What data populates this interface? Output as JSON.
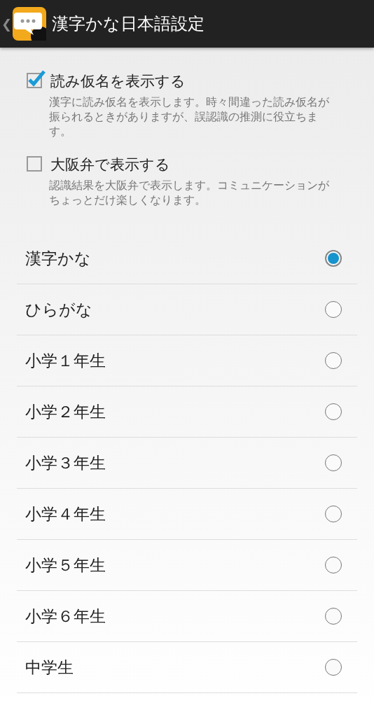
{
  "header": {
    "back": "❮",
    "title": "漢字かな日本語設定"
  },
  "checks": [
    {
      "label": "読み仮名を表示する",
      "description": "漢字に読み仮名を表示します。時々間違った読み仮名が振られるときがありますが、誤認識の推測に役立ちます。",
      "checked": true
    },
    {
      "label": "大阪弁で表示する",
      "description": "認識結果を大阪弁で表示します。コミュニケーションがちょっとだけ楽しくなります。",
      "checked": false
    }
  ],
  "options": [
    {
      "label": "漢字かな",
      "selected": true
    },
    {
      "label": "ひらがな",
      "selected": false
    },
    {
      "label": "小学１年生",
      "selected": false
    },
    {
      "label": "小学２年生",
      "selected": false
    },
    {
      "label": "小学３年生",
      "selected": false
    },
    {
      "label": "小学４年生",
      "selected": false
    },
    {
      "label": "小学５年生",
      "selected": false
    },
    {
      "label": "小学６年生",
      "selected": false
    },
    {
      "label": "中学生",
      "selected": false
    }
  ]
}
